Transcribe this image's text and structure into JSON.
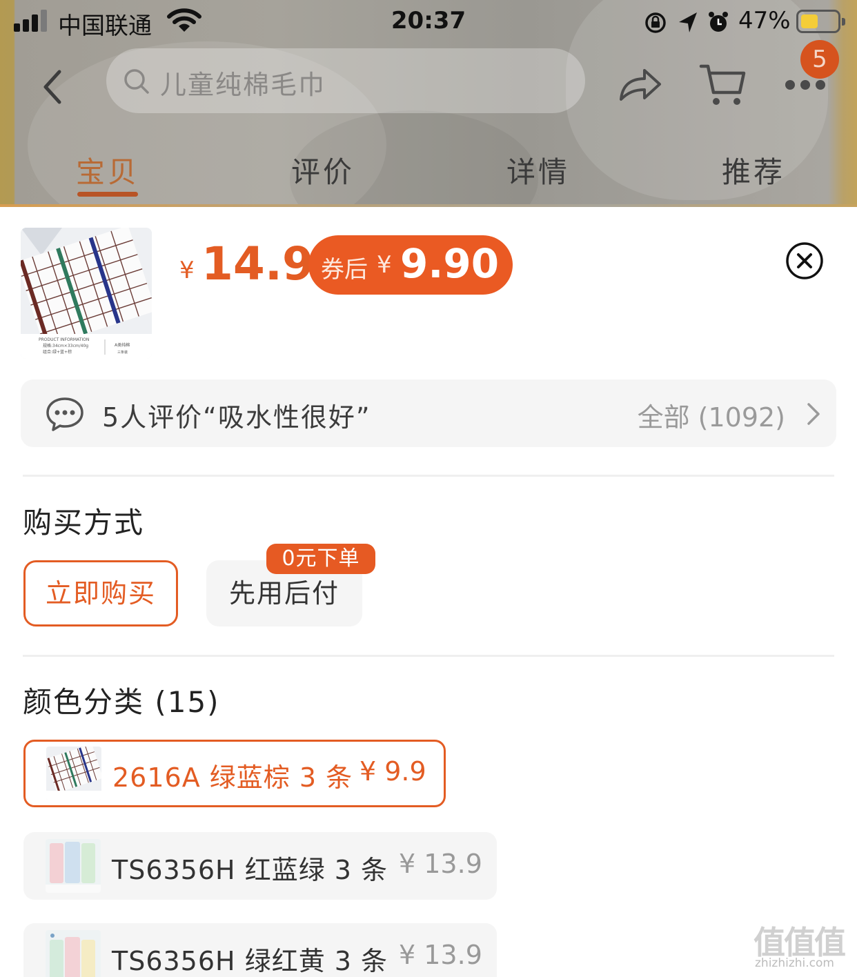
{
  "status_bar": {
    "carrier": "中国联通",
    "time": "20:37",
    "battery_percent": "47%",
    "battery_level": 0.47
  },
  "nav": {
    "search_placeholder": "儿童纯棉毛巾",
    "cart_badge": "5",
    "icons": [
      "chevron-left-icon",
      "search-icon",
      "share-icon",
      "cart-icon",
      "more-icon"
    ]
  },
  "tabs": [
    {
      "label": "宝贝",
      "active": true
    },
    {
      "label": "评价",
      "active": false
    },
    {
      "label": "详情",
      "active": false
    },
    {
      "label": "推荐",
      "active": false
    }
  ],
  "product": {
    "currency": "¥",
    "price": "14.9",
    "coupon_label": "券后",
    "coupon_price": "9.90",
    "thumbnail_text": {
      "line1": "PRODUCT INFORMATION",
      "line2": "规格:34cm×33cm/40g",
      "line3": "组合:绿+蓝+棕",
      "side1": "A类纯棉",
      "side2": "三条装"
    }
  },
  "reviews": {
    "summary": "5人评价“吸水性很好”",
    "all_label": "全部 (1092)"
  },
  "purchase": {
    "title": "购买方式",
    "buy_now": "立即购买",
    "pay_later": "先用后付",
    "pay_later_tag": "0元下单"
  },
  "variants": {
    "title": "颜色分类 (15)",
    "items": [
      {
        "name": "2616A 绿蓝棕 3 条",
        "price": "¥ 9.9",
        "selected": true
      },
      {
        "name": "TS6356H 红蓝绿 3 条",
        "price": "¥ 13.9",
        "selected": false
      },
      {
        "name": "TS6356H 绿红黄 3 条",
        "price": "¥ 13.9",
        "selected": false
      }
    ]
  },
  "watermark": {
    "glyphs": "值值值",
    "url": "zhizhizhi.com"
  },
  "colors": {
    "accent": "#e35c23",
    "coupon_bg": "#ea5a23",
    "tab_active": "#b86a35",
    "badge": "#d6531e"
  }
}
